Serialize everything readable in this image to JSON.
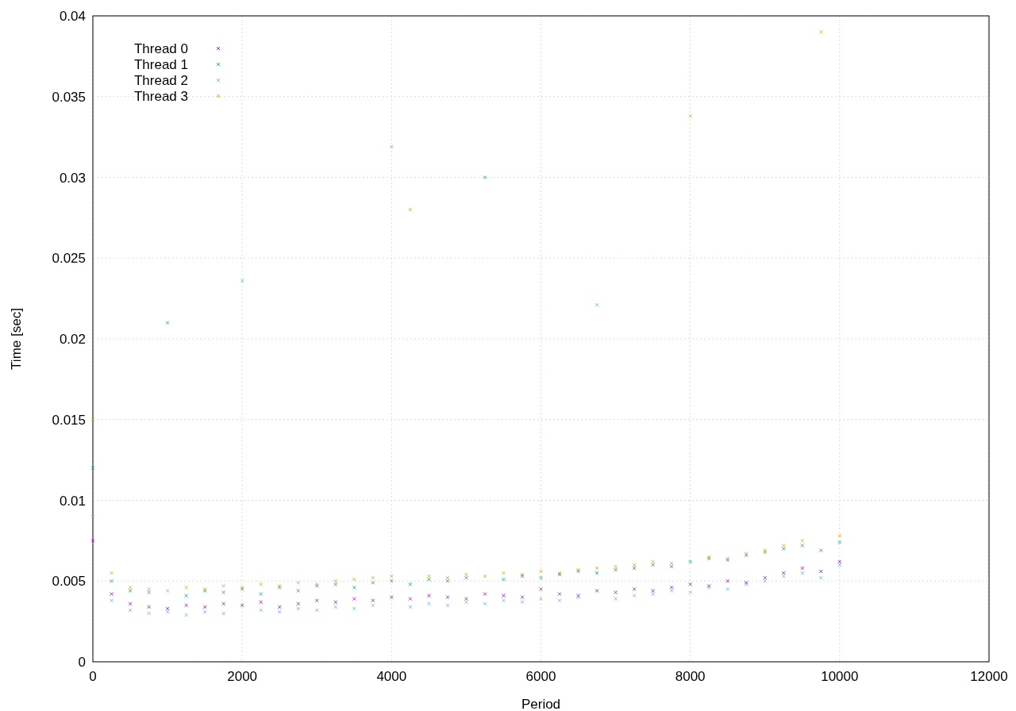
{
  "chart_data": {
    "type": "scatter",
    "grid": true,
    "legend": true,
    "xlabel": "Period",
    "ylabel": "Time [sec]",
    "xlim": [
      0,
      12000
    ],
    "ylim": [
      0,
      0.04
    ],
    "xticks": [
      0,
      2000,
      4000,
      6000,
      8000,
      10000,
      12000
    ],
    "yticks": [
      {
        "value": 0,
        "label": "0"
      },
      {
        "value": 0.005,
        "label": "0.005"
      },
      {
        "value": 0.01,
        "label": "0.01"
      },
      {
        "value": 0.015,
        "label": "0.015"
      },
      {
        "value": 0.02,
        "label": "0.02"
      },
      {
        "value": 0.025,
        "label": "0.025"
      },
      {
        "value": 0.03,
        "label": "0.03"
      },
      {
        "value": 0.035,
        "label": "0.035"
      },
      {
        "value": 0.04,
        "label": "0.04"
      }
    ],
    "x": [
      0,
      250,
      500,
      750,
      1000,
      1250,
      1500,
      1750,
      2000,
      2250,
      2500,
      2750,
      3000,
      3250,
      3500,
      3750,
      4000,
      4250,
      4500,
      4750,
      5000,
      5250,
      5500,
      5750,
      6000,
      6250,
      6500,
      6750,
      7000,
      7250,
      7500,
      7750,
      8000,
      8250,
      8500,
      8750,
      9000,
      9250,
      9500,
      9750,
      10000
    ],
    "series": [
      {
        "name": "Thread 0",
        "color": "#9400d3",
        "values": [
          0.0075,
          0.0042,
          0.0036,
          0.0034,
          0.0033,
          0.0035,
          0.0034,
          0.0036,
          0.0035,
          0.0037,
          0.0034,
          0.0036,
          0.0038,
          0.0037,
          0.0039,
          0.0038,
          0.004,
          0.0039,
          0.0041,
          0.004,
          0.0039,
          0.0042,
          0.0041,
          0.004,
          0.0045,
          0.0042,
          0.0041,
          0.0044,
          0.0043,
          0.0045,
          0.0044,
          0.0046,
          0.0048,
          0.0047,
          0.005,
          0.0049,
          0.0052,
          0.0055,
          0.0058,
          0.0056,
          0.0062
        ]
      },
      {
        "name": "Thread 1",
        "color": "#009e73",
        "values": [
          0.012,
          0.005,
          0.0044,
          0.0043,
          0.021,
          0.0041,
          0.0044,
          0.0043,
          0.0045,
          0.0042,
          0.0046,
          0.0044,
          0.0047,
          0.0048,
          0.0046,
          0.0049,
          0.005,
          0.0048,
          0.0051,
          0.005,
          0.0052,
          0.03,
          0.0051,
          0.0053,
          0.0052,
          0.0054,
          0.0056,
          0.0055,
          0.0057,
          0.0058,
          0.006,
          0.0059,
          0.0062,
          0.0064,
          0.0063,
          0.0066,
          0.0068,
          0.007,
          0.0072,
          0.0069,
          0.0074
        ]
      },
      {
        "name": "Thread 2",
        "color": "#56b4e9",
        "values": [
          0.009,
          0.0038,
          0.0032,
          0.003,
          0.0031,
          0.0029,
          0.0031,
          0.003,
          0.0236,
          0.0032,
          0.0031,
          0.0033,
          0.0032,
          0.0034,
          0.0033,
          0.0035,
          0.0319,
          0.0034,
          0.0036,
          0.0035,
          0.0037,
          0.0036,
          0.0038,
          0.0037,
          0.0039,
          0.0038,
          0.004,
          0.0221,
          0.0039,
          0.0041,
          0.0042,
          0.0044,
          0.0043,
          0.0046,
          0.0045,
          0.0048,
          0.005,
          0.0053,
          0.0055,
          0.0052,
          0.006
        ]
      },
      {
        "name": "Thread 3",
        "color": "#e69f00",
        "values": [
          0.015,
          0.0055,
          0.0046,
          0.0045,
          0.0044,
          0.0046,
          0.0045,
          0.0047,
          0.0046,
          0.0048,
          0.0047,
          0.0049,
          0.0048,
          0.005,
          0.0051,
          0.0052,
          0.0053,
          0.028,
          0.0053,
          0.0052,
          0.0054,
          0.0053,
          0.0055,
          0.0054,
          0.0056,
          0.0055,
          0.0057,
          0.0058,
          0.0059,
          0.006,
          0.0062,
          0.0061,
          0.0338,
          0.0065,
          0.0064,
          0.0067,
          0.0069,
          0.0072,
          0.0075,
          0.039,
          0.0078
        ]
      }
    ]
  }
}
